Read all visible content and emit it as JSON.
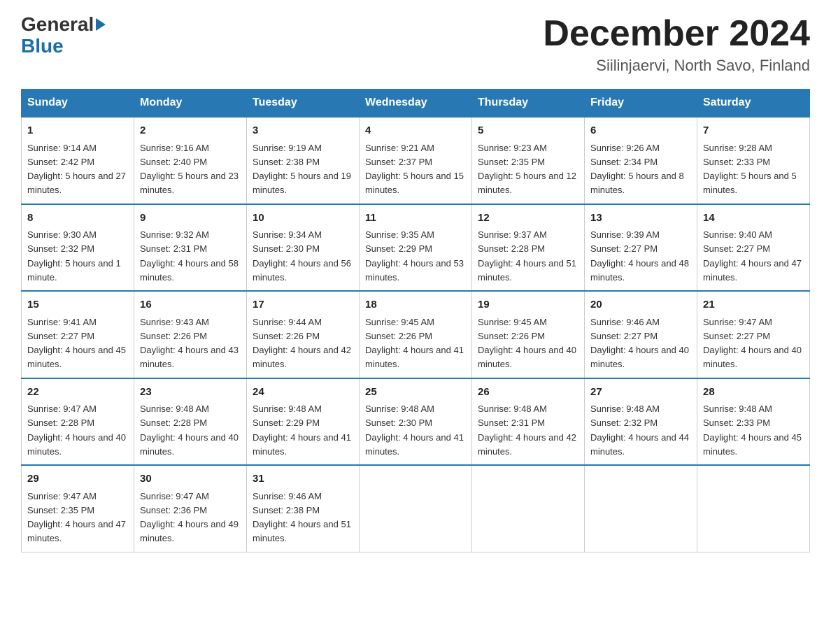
{
  "header": {
    "logo_line1": "General",
    "logo_line2": "Blue",
    "month_title": "December 2024",
    "location": "Siilinjaervi, North Savo, Finland"
  },
  "days_of_week": [
    "Sunday",
    "Monday",
    "Tuesday",
    "Wednesday",
    "Thursday",
    "Friday",
    "Saturday"
  ],
  "weeks": [
    [
      {
        "day": "1",
        "sunrise": "9:14 AM",
        "sunset": "2:42 PM",
        "daylight": "5 hours and 27 minutes."
      },
      {
        "day": "2",
        "sunrise": "9:16 AM",
        "sunset": "2:40 PM",
        "daylight": "5 hours and 23 minutes."
      },
      {
        "day": "3",
        "sunrise": "9:19 AM",
        "sunset": "2:38 PM",
        "daylight": "5 hours and 19 minutes."
      },
      {
        "day": "4",
        "sunrise": "9:21 AM",
        "sunset": "2:37 PM",
        "daylight": "5 hours and 15 minutes."
      },
      {
        "day": "5",
        "sunrise": "9:23 AM",
        "sunset": "2:35 PM",
        "daylight": "5 hours and 12 minutes."
      },
      {
        "day": "6",
        "sunrise": "9:26 AM",
        "sunset": "2:34 PM",
        "daylight": "5 hours and 8 minutes."
      },
      {
        "day": "7",
        "sunrise": "9:28 AM",
        "sunset": "2:33 PM",
        "daylight": "5 hours and 5 minutes."
      }
    ],
    [
      {
        "day": "8",
        "sunrise": "9:30 AM",
        "sunset": "2:32 PM",
        "daylight": "5 hours and 1 minute."
      },
      {
        "day": "9",
        "sunrise": "9:32 AM",
        "sunset": "2:31 PM",
        "daylight": "4 hours and 58 minutes."
      },
      {
        "day": "10",
        "sunrise": "9:34 AM",
        "sunset": "2:30 PM",
        "daylight": "4 hours and 56 minutes."
      },
      {
        "day": "11",
        "sunrise": "9:35 AM",
        "sunset": "2:29 PM",
        "daylight": "4 hours and 53 minutes."
      },
      {
        "day": "12",
        "sunrise": "9:37 AM",
        "sunset": "2:28 PM",
        "daylight": "4 hours and 51 minutes."
      },
      {
        "day": "13",
        "sunrise": "9:39 AM",
        "sunset": "2:27 PM",
        "daylight": "4 hours and 48 minutes."
      },
      {
        "day": "14",
        "sunrise": "9:40 AM",
        "sunset": "2:27 PM",
        "daylight": "4 hours and 47 minutes."
      }
    ],
    [
      {
        "day": "15",
        "sunrise": "9:41 AM",
        "sunset": "2:27 PM",
        "daylight": "4 hours and 45 minutes."
      },
      {
        "day": "16",
        "sunrise": "9:43 AM",
        "sunset": "2:26 PM",
        "daylight": "4 hours and 43 minutes."
      },
      {
        "day": "17",
        "sunrise": "9:44 AM",
        "sunset": "2:26 PM",
        "daylight": "4 hours and 42 minutes."
      },
      {
        "day": "18",
        "sunrise": "9:45 AM",
        "sunset": "2:26 PM",
        "daylight": "4 hours and 41 minutes."
      },
      {
        "day": "19",
        "sunrise": "9:45 AM",
        "sunset": "2:26 PM",
        "daylight": "4 hours and 40 minutes."
      },
      {
        "day": "20",
        "sunrise": "9:46 AM",
        "sunset": "2:27 PM",
        "daylight": "4 hours and 40 minutes."
      },
      {
        "day": "21",
        "sunrise": "9:47 AM",
        "sunset": "2:27 PM",
        "daylight": "4 hours and 40 minutes."
      }
    ],
    [
      {
        "day": "22",
        "sunrise": "9:47 AM",
        "sunset": "2:28 PM",
        "daylight": "4 hours and 40 minutes."
      },
      {
        "day": "23",
        "sunrise": "9:48 AM",
        "sunset": "2:28 PM",
        "daylight": "4 hours and 40 minutes."
      },
      {
        "day": "24",
        "sunrise": "9:48 AM",
        "sunset": "2:29 PM",
        "daylight": "4 hours and 41 minutes."
      },
      {
        "day": "25",
        "sunrise": "9:48 AM",
        "sunset": "2:30 PM",
        "daylight": "4 hours and 41 minutes."
      },
      {
        "day": "26",
        "sunrise": "9:48 AM",
        "sunset": "2:31 PM",
        "daylight": "4 hours and 42 minutes."
      },
      {
        "day": "27",
        "sunrise": "9:48 AM",
        "sunset": "2:32 PM",
        "daylight": "4 hours and 44 minutes."
      },
      {
        "day": "28",
        "sunrise": "9:48 AM",
        "sunset": "2:33 PM",
        "daylight": "4 hours and 45 minutes."
      }
    ],
    [
      {
        "day": "29",
        "sunrise": "9:47 AM",
        "sunset": "2:35 PM",
        "daylight": "4 hours and 47 minutes."
      },
      {
        "day": "30",
        "sunrise": "9:47 AM",
        "sunset": "2:36 PM",
        "daylight": "4 hours and 49 minutes."
      },
      {
        "day": "31",
        "sunrise": "9:46 AM",
        "sunset": "2:38 PM",
        "daylight": "4 hours and 51 minutes."
      },
      null,
      null,
      null,
      null
    ]
  ]
}
